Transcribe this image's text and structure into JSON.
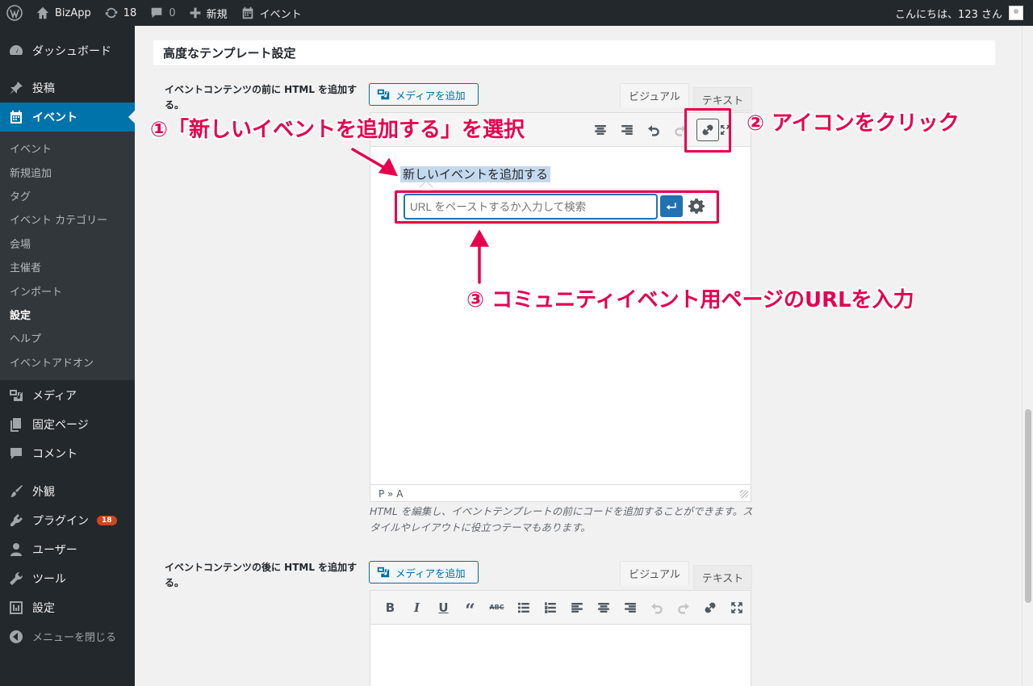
{
  "adminbar": {
    "site_name": "BizApp",
    "updates_count": "18",
    "comments_count": "0",
    "new_label": "新規",
    "event_label": "イベント",
    "greeting": "こんにちは、123 さん"
  },
  "sidebar": {
    "dashboard": "ダッシュボード",
    "posts": "投稿",
    "events": "イベント",
    "submenu": [
      "イベント",
      "新規追加",
      "タグ",
      "イベント カテゴリー",
      "会場",
      "主催者",
      "インポート",
      "設定",
      "ヘルプ",
      "イベントアドオン"
    ],
    "media": "メディア",
    "pages": "固定ページ",
    "comments": "コメント",
    "appearance": "外観",
    "plugins": "プラグイン",
    "plugins_badge": "18",
    "users": "ユーザー",
    "tools": "ツール",
    "settings": "設定",
    "collapse": "メニューを閉じる"
  },
  "section_title": "高度なテンプレート設定",
  "editor1": {
    "label": "イベントコンテンツの前に HTML を追加する。",
    "media_button": "メディアを追加",
    "tab_visual": "ビジュアル",
    "tab_text": "テキスト",
    "selected_text": "新しいイベントを追加する",
    "url_placeholder": "URL をペーストするか入力して検索",
    "status_path": "P » A",
    "description": "HTML を編集し、イベントテンプレートの前にコードを追加することができます。スタイルやレイアウトに役立つテーマもあります。"
  },
  "editor2": {
    "label": "イベントコンテンツの後に HTML を追加する。",
    "media_button": "メディアを追加",
    "tab_visual": "ビジュアル",
    "tab_text": "テキスト"
  },
  "annotations": {
    "step1": "①「新しいイベントを追加する」を選択",
    "step2": "② アイコンをクリック",
    "step3": "③ コミュニティイベント用ページのURLを入力"
  },
  "colors": {
    "admin_dark": "#23282d",
    "wp_blue": "#0073aa",
    "annotation_pink": "#e6004d"
  }
}
